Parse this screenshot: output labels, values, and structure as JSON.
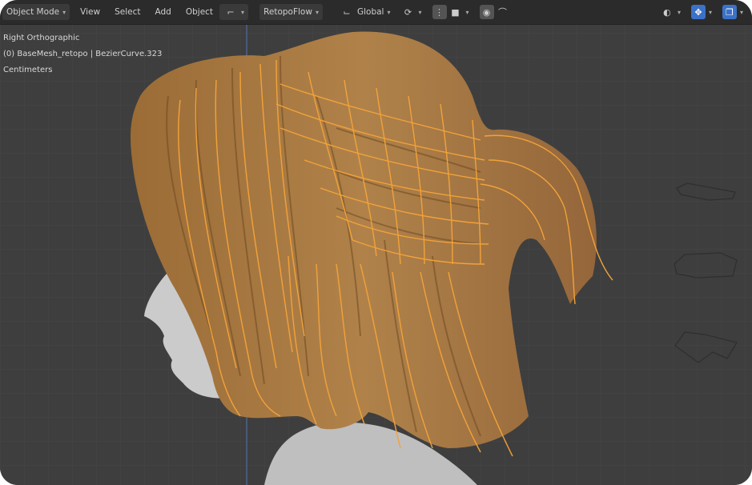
{
  "toolbar": {
    "mode": "Object Mode",
    "menus": [
      "View",
      "Select",
      "Add",
      "Object"
    ],
    "addon_menu": "RetopoFlow",
    "orientation": "Global"
  },
  "overlay": {
    "view_name": "Right Orthographic",
    "object_info": "(0) BaseMesh_retopo | BezierCurve.323",
    "units": "Centimeters"
  },
  "colors": {
    "hair": "#a87940",
    "curve": "#f2a23a",
    "skin": "#c9c9c9",
    "viewport_bg": "#3e3e3e",
    "accent": "#3b72c7"
  }
}
